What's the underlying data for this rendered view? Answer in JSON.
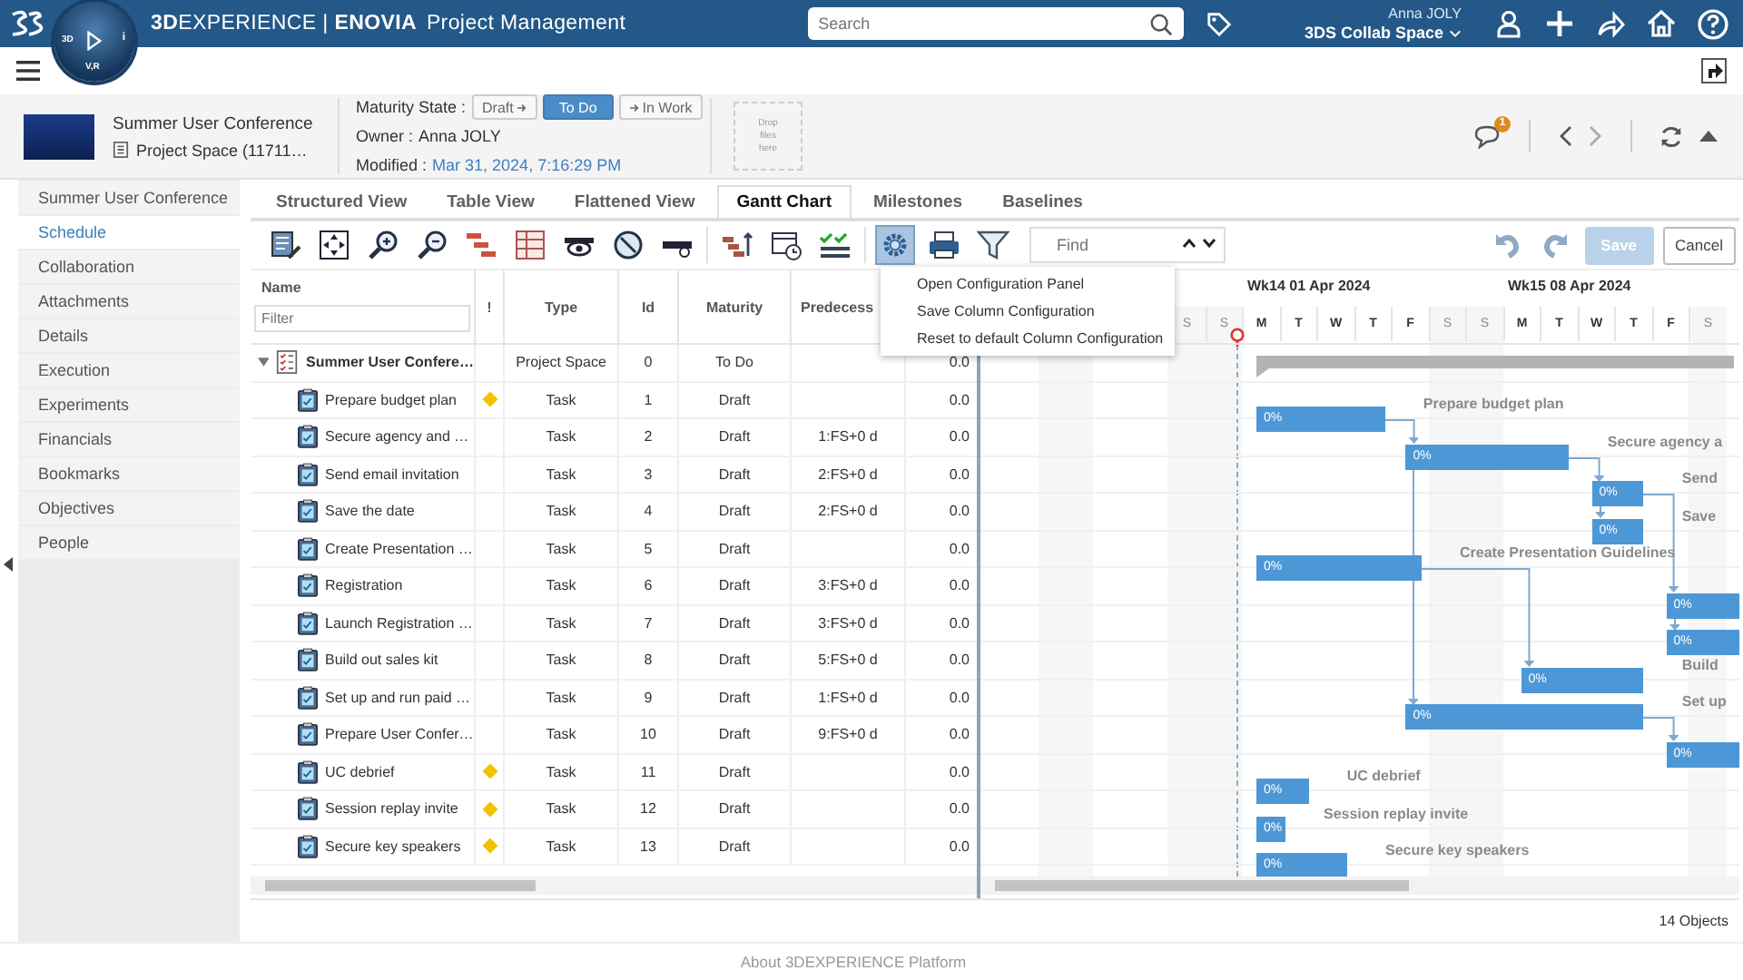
{
  "top_bar": {
    "brand_bold": "3D",
    "brand_rest": "EXPERIENCE",
    "separator": "|",
    "app_brand": "ENOVIA",
    "app_name": "Project Management",
    "search": {
      "placeholder": "Search"
    },
    "user": {
      "name": "Anna JOLY",
      "collab_space": "3DS Collab Space"
    }
  },
  "compass": {
    "west": "3D",
    "east": "i",
    "south": "V,R"
  },
  "object_header": {
    "title": "Summer User Conference",
    "subtitle": "Project Space (11711…",
    "maturity_label": "Maturity State :",
    "states": [
      {
        "label": "Draft",
        "selected": false,
        "kind": "previous"
      },
      {
        "label": "To Do",
        "selected": true,
        "kind": "current"
      },
      {
        "label": "In Work",
        "selected": false,
        "kind": "next"
      }
    ],
    "owner_label": "Owner :",
    "owner": "Anna JOLY",
    "modified_label": "Modified :",
    "modified": "Mar 31, 2024, 7:16:29 PM",
    "drop_zone": "Drop files here",
    "notification_count": "1"
  },
  "sidebar": {
    "items": [
      {
        "label": "Summer User Conference",
        "selected": false
      },
      {
        "label": "Schedule",
        "selected": true
      },
      {
        "label": "Collaboration",
        "selected": false
      },
      {
        "label": "Attachments",
        "selected": false
      },
      {
        "label": "Details",
        "selected": false
      },
      {
        "label": "Execution",
        "selected": false
      },
      {
        "label": "Experiments",
        "selected": false
      },
      {
        "label": "Financials",
        "selected": false
      },
      {
        "label": "Bookmarks",
        "selected": false
      },
      {
        "label": "Objectives",
        "selected": false
      },
      {
        "label": "People",
        "selected": false
      }
    ]
  },
  "tabs": [
    {
      "label": "Structured View",
      "selected": false
    },
    {
      "label": "Table View",
      "selected": false
    },
    {
      "label": "Flattened View",
      "selected": false
    },
    {
      "label": "Gantt Chart",
      "selected": true
    },
    {
      "label": "Milestones",
      "selected": false
    },
    {
      "label": "Baselines",
      "selected": false
    }
  ],
  "toolbar": {
    "find": {
      "placeholder": "Find"
    },
    "config_menu": {
      "open": true,
      "items": [
        "Open Configuration Panel",
        "Save Column Configuration",
        "Reset to default Column Configuration"
      ]
    },
    "save": {
      "label": "Save",
      "disabled": true
    },
    "cancel": {
      "label": "Cancel",
      "disabled": false
    }
  },
  "grid": {
    "columns": [
      "Name",
      "!",
      "Type",
      "Id",
      "Maturity",
      "Predecess"
    ],
    "filter": {
      "placeholder": "Filter"
    },
    "root": {
      "name": "Summer User Confere…",
      "type": "Project Space",
      "id": "0",
      "maturity": "To Do",
      "column_7": "0.0",
      "expanded": true,
      "children": [
        {
          "name": "Prepare budget plan",
          "flag": true,
          "type": "Task",
          "id": "1",
          "maturity": "Draft",
          "column_7": "0.0"
        },
        {
          "name": "Secure agency and …",
          "flag": false,
          "type": "Task",
          "id": "2",
          "maturity": "Draft",
          "predecessor": "1:FS+0 d",
          "column_7": "0.0"
        },
        {
          "name": "Send email invitation",
          "flag": false,
          "type": "Task",
          "id": "3",
          "maturity": "Draft",
          "predecessor": "2:FS+0 d",
          "column_7": "0.0"
        },
        {
          "name": "Save the date",
          "flag": false,
          "type": "Task",
          "id": "4",
          "maturity": "Draft",
          "predecessor": "2:FS+0 d",
          "column_7": "0.0"
        },
        {
          "name": "Create Presentation …",
          "flag": false,
          "type": "Task",
          "id": "5",
          "maturity": "Draft",
          "column_7": "0.0"
        },
        {
          "name": "Registration",
          "flag": false,
          "type": "Task",
          "id": "6",
          "maturity": "Draft",
          "predecessor": "3:FS+0 d",
          "column_7": "0.0"
        },
        {
          "name": "Launch Registration …",
          "flag": false,
          "type": "Task",
          "id": "7",
          "maturity": "Draft",
          "predecessor": "3:FS+0 d",
          "column_7": "0.0"
        },
        {
          "name": "Build out sales kit",
          "flag": false,
          "type": "Task",
          "id": "8",
          "maturity": "Draft",
          "predecessor": "5:FS+0 d",
          "column_7": "0.0"
        },
        {
          "name": "Set up and run paid …",
          "flag": false,
          "type": "Task",
          "id": "9",
          "maturity": "Draft",
          "predecessor": "1:FS+0 d",
          "column_7": "0.0"
        },
        {
          "name": "Prepare User Confer…",
          "flag": false,
          "type": "Task",
          "id": "10",
          "maturity": "Draft",
          "predecessor": "9:FS+0 d",
          "column_7": "0.0"
        },
        {
          "name": "UC debrief",
          "flag": true,
          "type": "Task",
          "id": "11",
          "maturity": "Draft",
          "column_7": "0.0"
        },
        {
          "name": "Session replay invite",
          "flag": true,
          "type": "Task",
          "id": "12",
          "maturity": "Draft",
          "column_7": "0.0"
        },
        {
          "name": "Secure key speakers",
          "flag": true,
          "type": "Task",
          "id": "13",
          "maturity": "Draft",
          "column_7": "0.0"
        }
      ]
    }
  },
  "gantt": {
    "weeks": [
      "Wk14 01 Apr 2024",
      "Wk15 08 Apr 2024"
    ],
    "days": [
      {
        "label": "S",
        "weekend": true
      },
      {
        "label": "S",
        "weekend": true
      },
      {
        "label": "M",
        "weekend": false
      },
      {
        "label": "T",
        "weekend": false
      },
      {
        "label": "W",
        "weekend": false
      },
      {
        "label": "T",
        "weekend": false
      },
      {
        "label": "F",
        "weekend": false
      },
      {
        "label": "S",
        "weekend": true
      },
      {
        "label": "S",
        "weekend": true
      },
      {
        "label": "M",
        "weekend": false
      },
      {
        "label": "T",
        "weekend": false
      },
      {
        "label": "W",
        "weekend": false
      },
      {
        "label": "T",
        "weekend": false
      },
      {
        "label": "F",
        "weekend": false
      },
      {
        "label": "S",
        "weekend": true
      }
    ],
    "bars": [
      {
        "progress": "0%",
        "label": "Prepare budget plan"
      },
      {
        "progress": "0%",
        "label": "Secure agency a"
      },
      {
        "progress": "0%",
        "label": "Send"
      },
      {
        "progress": "0%",
        "label": "Save"
      },
      {
        "progress": "0%",
        "label": "Create Presentation Guidelines"
      },
      {
        "progress": "0%"
      },
      {
        "progress": "0%"
      },
      {
        "progress": "0%",
        "label": "Build"
      },
      {
        "progress": "0%",
        "label": "Set up"
      },
      {
        "progress": "0%"
      },
      {
        "progress": "0%",
        "label": "UC debrief"
      },
      {
        "progress": "0%",
        "label": "Session replay invite"
      },
      {
        "progress": "0%",
        "label": "Secure key speakers"
      }
    ]
  },
  "status_bar": {
    "count": "14 Objects"
  },
  "footer": {
    "link": "About 3DEXPERIENCE Platform"
  }
}
